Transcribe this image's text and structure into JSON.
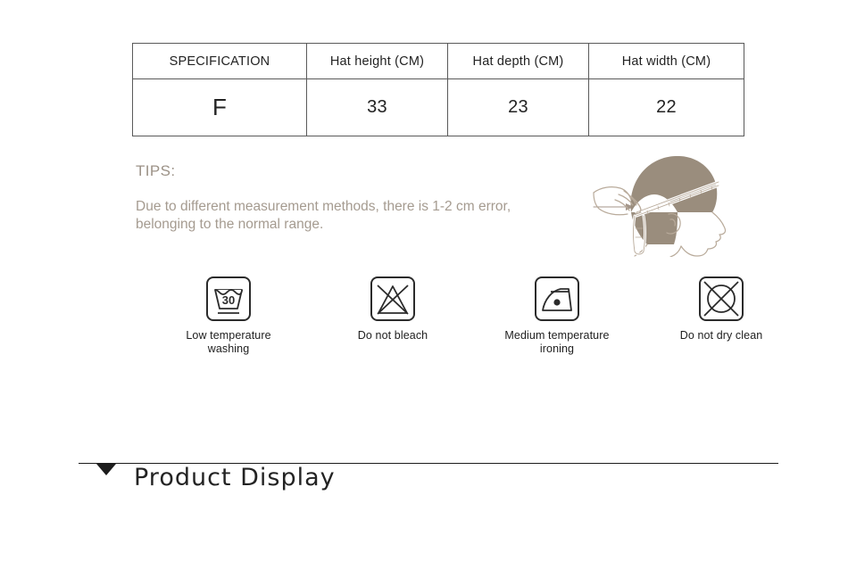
{
  "spec_table": {
    "headers": [
      "SPECIFICATION",
      "Hat height (CM)",
      "Hat depth (CM)",
      "Hat width (CM)"
    ],
    "rows": [
      {
        "size": "F",
        "hat_height": "33",
        "hat_depth": "23",
        "hat_width": "22"
      }
    ]
  },
  "tips": {
    "title": "TIPS:",
    "line1": "Due to different measurement methods, there is 1-2 cm error,",
    "line2": "belonging to the normal range."
  },
  "illustration": {
    "name": "head-measuring-tape-illustration",
    "hat_color": "#9a8d7d",
    "outline_color": "#b9ab9b"
  },
  "care_symbols": [
    {
      "icon": "wash-30-icon",
      "label_line1": "Low temperature",
      "label_line2": "washing",
      "temperature": "30"
    },
    {
      "icon": "do-not-bleach-icon",
      "label_line1": "Do not bleach",
      "label_line2": ""
    },
    {
      "icon": "iron-medium-icon",
      "label_line1": "Medium temperature",
      "label_line2": "ironing"
    },
    {
      "icon": "do-not-dry-clean-icon",
      "label_line1": "Do not dry clean",
      "label_line2": ""
    }
  ],
  "section": {
    "title": "Product  Display"
  },
  "colors": {
    "text": "#232323",
    "tips_text": "#a59b90",
    "table_border": "#5a5a5a",
    "rule": "#1c1c1c"
  }
}
